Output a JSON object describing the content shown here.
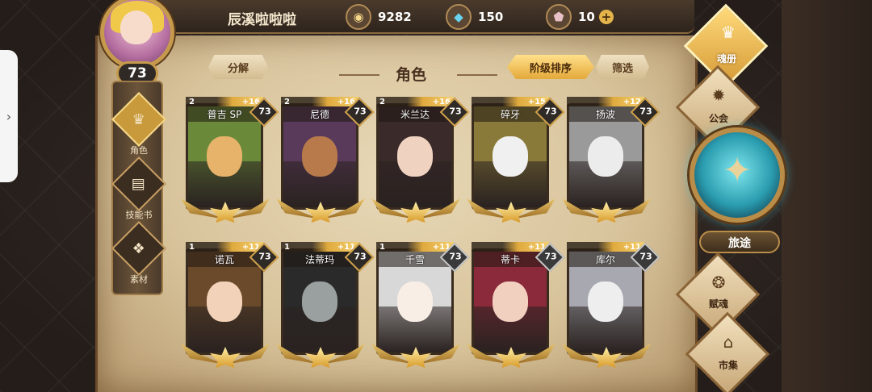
{
  "player": {
    "name": "辰溪啦啦啦",
    "level": "73"
  },
  "resources": [
    {
      "icon": "gold-coin-icon",
      "glyph": "◉",
      "value": "9282"
    },
    {
      "icon": "blue-crystal-icon",
      "glyph": "◆",
      "value": "150"
    },
    {
      "icon": "gem-icon",
      "glyph": "⬟",
      "value": "10",
      "plus": "+"
    }
  ],
  "left_menu": [
    {
      "label": "角色",
      "glyph": "♛",
      "active": true
    },
    {
      "label": "技能书",
      "glyph": "▤",
      "active": false
    },
    {
      "label": "素材",
      "glyph": "❖",
      "active": false
    }
  ],
  "header": {
    "title": "角色",
    "decompose": "分解",
    "sort": "阶级排序",
    "filter": "筛选"
  },
  "cards": [
    {
      "name": "普吉 SP",
      "level": "73",
      "stars": "2",
      "bonus": "+16",
      "gold": true,
      "palette": [
        "#6a8a3a",
        "#e7b26a"
      ]
    },
    {
      "name": "尼德",
      "level": "73",
      "stars": "2",
      "bonus": "+16",
      "gold": true,
      "palette": [
        "#5a3a5a",
        "#b87a4a"
      ]
    },
    {
      "name": "米兰达",
      "level": "73",
      "stars": "2",
      "bonus": "+16",
      "gold": true,
      "palette": [
        "#3a2a2a",
        "#f0d2c0"
      ]
    },
    {
      "name": "碎牙",
      "level": "73",
      "stars": "",
      "bonus": "+15",
      "gold": true,
      "palette": [
        "#8a7a3a",
        "#f0f0f0"
      ]
    },
    {
      "name": "扬波",
      "level": "73",
      "stars": "",
      "bonus": "+12",
      "gold": true,
      "palette": [
        "#9a9a9a",
        "#ececec"
      ]
    },
    {
      "name": "诺瓦",
      "level": "73",
      "stars": "1",
      "bonus": "+11",
      "gold": true,
      "palette": [
        "#6a4a2a",
        "#f2d2b8"
      ]
    },
    {
      "name": "法蒂玛",
      "level": "73",
      "stars": "1",
      "bonus": "+11",
      "gold": true,
      "palette": [
        "#2a2a2a",
        "#9aa0a0"
      ]
    },
    {
      "name": "千雪",
      "level": "73",
      "stars": "1",
      "bonus": "+11",
      "gold": false,
      "palette": [
        "#d8d8d8",
        "#f8eee6"
      ]
    },
    {
      "name": "蒂卡",
      "level": "73",
      "stars": "",
      "bonus": "+11",
      "gold": false,
      "palette": [
        "#8a2a3a",
        "#f2d0c0"
      ]
    },
    {
      "name": "库尔",
      "level": "73",
      "stars": "",
      "bonus": "+11",
      "gold": false,
      "palette": [
        "#a8a8b0",
        "#eeeeee"
      ]
    }
  ],
  "right_nav": [
    {
      "label": "魂册",
      "glyph": "♛",
      "active": true
    },
    {
      "label": "公会",
      "glyph": "✹",
      "active": false
    },
    {
      "label": "赋魂",
      "glyph": "❂",
      "active": false
    },
    {
      "label": "市集",
      "glyph": "⌂",
      "active": false
    }
  ],
  "journey": {
    "label": "旅途",
    "glyph": "✦"
  },
  "side_tab": {
    "glyph": "›"
  }
}
